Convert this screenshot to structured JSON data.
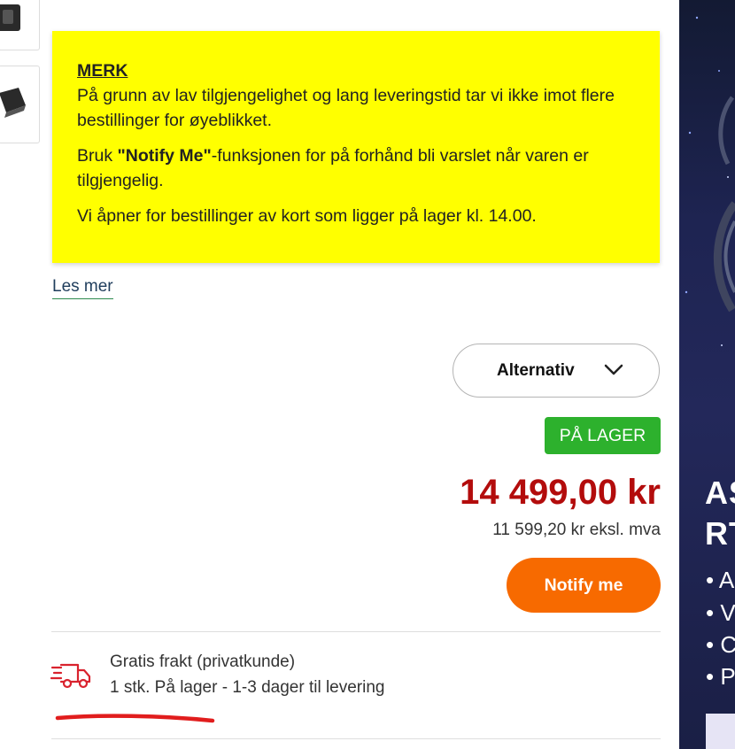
{
  "notice": {
    "heading": "MERK",
    "paragraph1": "På grunn av lav tilgjengelighet og lang leveringstid tar vi ikke imot flere bestillinger for øyeblikket.",
    "paragraph2_prefix": "Bruk ",
    "paragraph2_bold": "\"Notify Me\"",
    "paragraph2_suffix": "-funksjonen for på forhånd bli varslet når varen er tilgjengelig.",
    "paragraph3": "Vi åpner for bestillinger av kort som ligger på lager kl. 14.00."
  },
  "read_more_label": "Les mer",
  "alternative_button_label": "Alternativ",
  "stock_badge": "PÅ LAGER",
  "price": "14 499,00 kr",
  "price_ex_vat": "11 599,20 kr eksl. mva",
  "notify_button_label": "Notify me",
  "shipping": {
    "line1": "Gratis frakt (privatkunde)",
    "line2": "1 stk. På lager - 1-3 dager til levering"
  },
  "side_banner": {
    "title_line1": "AS",
    "title_line2": "RT",
    "bullets": [
      "• A",
      "• V",
      "• C",
      "• P"
    ]
  },
  "colors": {
    "notice_background": "#ffff00",
    "stock_badge": "#2db12d",
    "price": "#b30c0c",
    "notify_button": "#f76a00",
    "shipping_icon": "#d9232e"
  },
  "icons": {
    "alternative_chevron": "chevron-down-icon",
    "shipping": "delivery-truck-icon"
  }
}
